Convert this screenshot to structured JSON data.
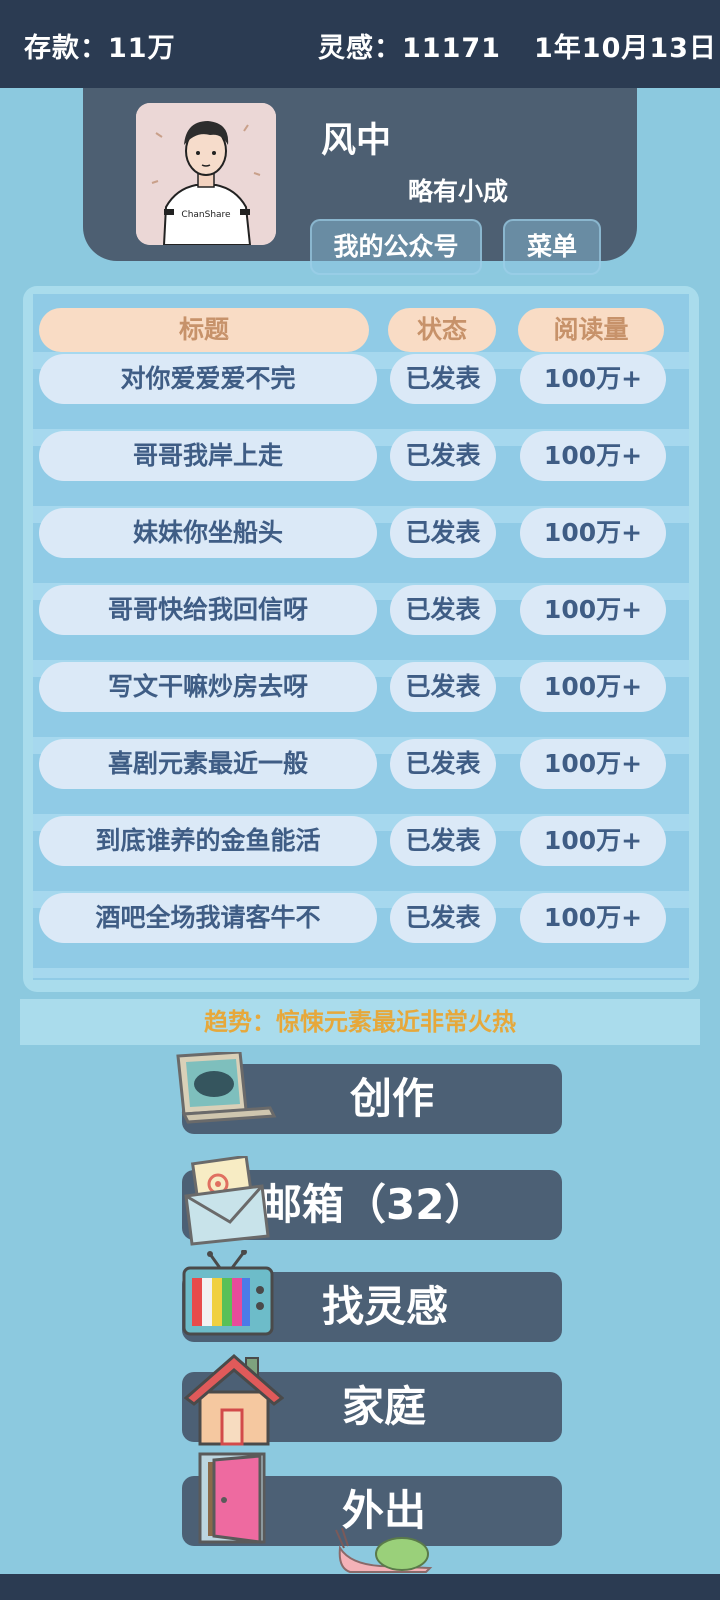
{
  "header": {
    "savings": "存款：11万",
    "inspiration": "灵感：11171",
    "date": "1年10月13日"
  },
  "profile": {
    "name": "风中",
    "rank": "略有小成",
    "avatar_shirt_text": "ChanShare",
    "official_account_button": "我的公众号",
    "menu_button": "菜单"
  },
  "table": {
    "headers": {
      "title": "标题",
      "status": "状态",
      "reads": "阅读量"
    },
    "rows": [
      {
        "title": "对你爱爱爱不完",
        "status": "已发表",
        "reads": "100万+"
      },
      {
        "title": "哥哥我岸上走",
        "status": "已发表",
        "reads": "100万+"
      },
      {
        "title": "妹妹你坐船头",
        "status": "已发表",
        "reads": "100万+"
      },
      {
        "title": "哥哥快给我回信呀",
        "status": "已发表",
        "reads": "100万+"
      },
      {
        "title": "写文干嘛炒房去呀",
        "status": "已发表",
        "reads": "100万+"
      },
      {
        "title": "喜剧元素最近一般",
        "status": "已发表",
        "reads": "100万+"
      },
      {
        "title": "到底谁养的金鱼能活",
        "status": "已发表",
        "reads": "100万+"
      },
      {
        "title": "酒吧全场我请客牛不",
        "status": "已发表",
        "reads": "100万+"
      }
    ]
  },
  "trend": "趋势：惊悚元素最近非常火热",
  "menu": {
    "create": "创作",
    "mailbox": "邮箱（32）",
    "inspiration": "找灵感",
    "family": "家庭",
    "go_out": "外出"
  },
  "icons": {
    "create": "laptop-icon",
    "mailbox": "envelope-icon",
    "inspiration": "tv-icon",
    "family": "house-icon",
    "go_out": "door-icon"
  },
  "colors": {
    "background": "#8cc9df",
    "topbar": "#2b3b52",
    "panel": "#4d5f72",
    "header_pill": "#f9dcc5",
    "cell_pill": "#dbe9f7",
    "trend_text": "#e6a83b"
  }
}
